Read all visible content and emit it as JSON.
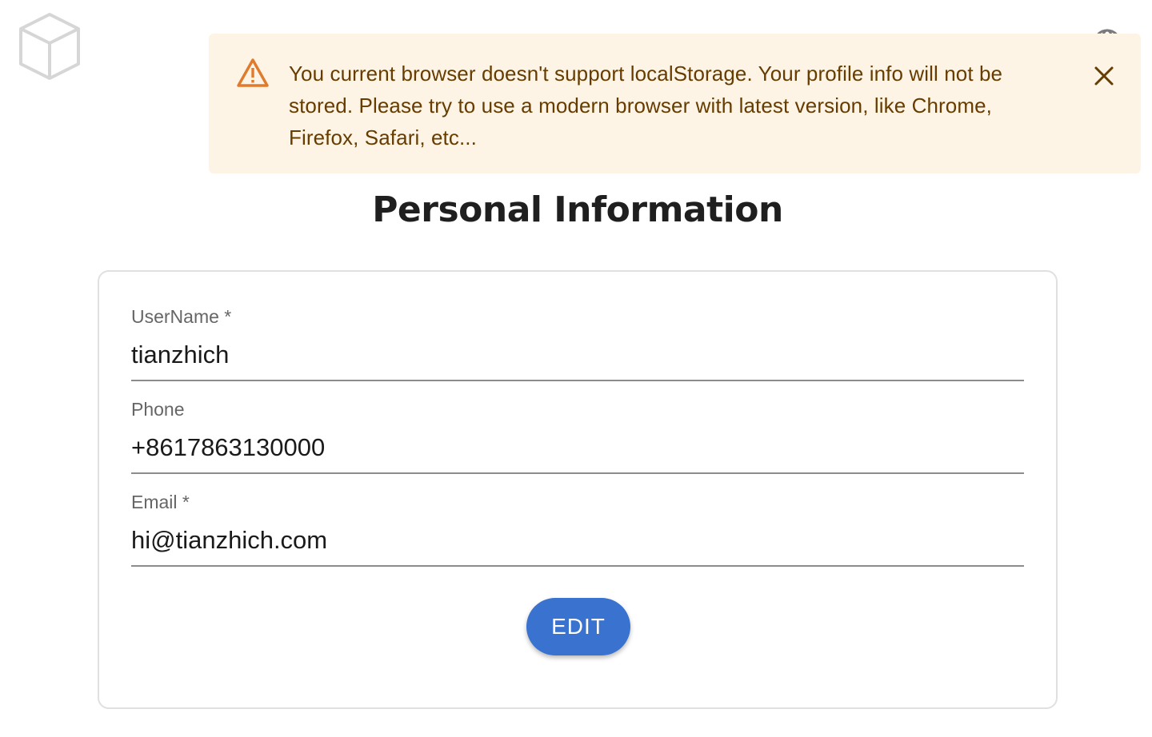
{
  "icons": {
    "logo": "cube-outline-icon",
    "language": "globe-icon",
    "alert": "warning-triangle-icon",
    "close": "close-x-icon"
  },
  "alert": {
    "message": "You current browser doesn't support localStorage. Your profile info will not be stored. Please try to use a modern browser with latest version, like Chrome, Firefox, Safari, etc..."
  },
  "page": {
    "title": "Personal Information"
  },
  "form": {
    "fields": [
      {
        "label": "UserName *",
        "value": "tianzhich"
      },
      {
        "label": "Phone",
        "value": "+8617863130000"
      },
      {
        "label": "Email *",
        "value": "hi@tianzhich.com"
      }
    ],
    "edit_label": "EDIT"
  },
  "colors": {
    "alert_background": "#fdf4e5",
    "alert_text": "#663c00",
    "alert_icon": "#e07a2c",
    "primary_button": "#3a72cf"
  }
}
